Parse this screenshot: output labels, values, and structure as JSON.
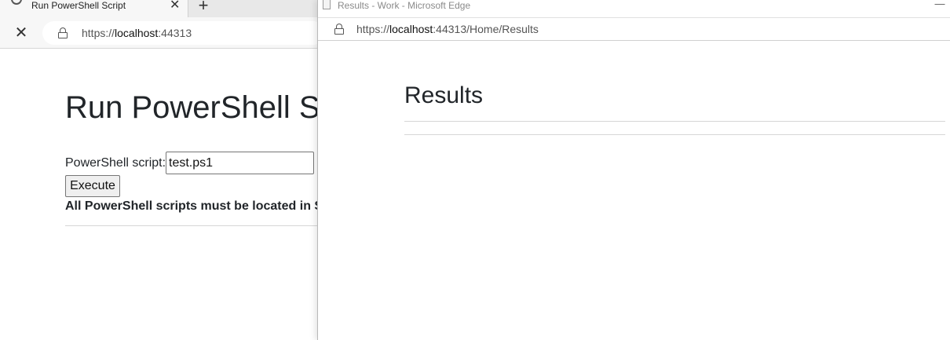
{
  "background_window": {
    "tab": {
      "title": "Run PowerShell Script",
      "close_glyph": "✕",
      "favicon": "loading-icon"
    },
    "new_tab_glyph": "+",
    "stop_glyph": "✕",
    "address": {
      "scheme": "https://",
      "host": "localhost",
      "port": ":44313"
    },
    "page": {
      "heading": "Run PowerShell Script",
      "script_label": "PowerShell script:",
      "script_input_value": "test.ps1",
      "execute_label": "Execute",
      "note": "All PowerShell scripts must be located in Scripts folder"
    }
  },
  "foreground_window": {
    "title": "Results - Work - Microsoft Edge",
    "minimize_glyph": "—",
    "address": {
      "scheme": "https://",
      "host": "localhost",
      "rest": ":44313/Home/Results"
    },
    "page": {
      "heading": "Results"
    }
  }
}
